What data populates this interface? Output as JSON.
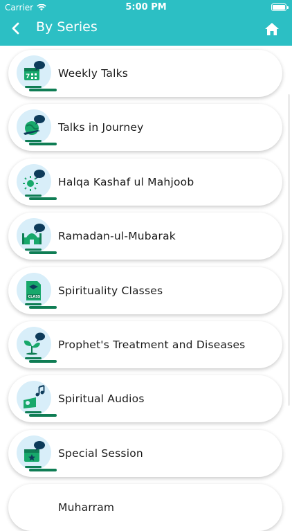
{
  "status_bar": {
    "carrier": "Carrier",
    "time": "5:00 PM"
  },
  "header": {
    "title": "By Series"
  },
  "series": [
    {
      "label": "Weekly Talks",
      "icon": "calendar-chat-icon"
    },
    {
      "label": "Talks in Journey",
      "icon": "globe-plane-icon"
    },
    {
      "label": "Halqa Kashaf ul Mahjoob",
      "icon": "network-chat-icon"
    },
    {
      "label": "Ramadan-ul-Mubarak",
      "icon": "mosque-icon"
    },
    {
      "label": "Spirituality Classes",
      "icon": "book-class-icon"
    },
    {
      "label": "Prophet's Treatment and Diseases",
      "icon": "leaf-icon"
    },
    {
      "label": "Spiritual Audios",
      "icon": "music-notes-icon"
    },
    {
      "label": "Special Session",
      "icon": "calendar-star-icon"
    },
    {
      "label": "Muharram",
      "icon": ""
    }
  ],
  "colors": {
    "header": "#2cbfc4",
    "accent_green": "#0f7d54",
    "icon_bg": "#d8eef9",
    "chat_bubble": "#0d3b5a"
  }
}
